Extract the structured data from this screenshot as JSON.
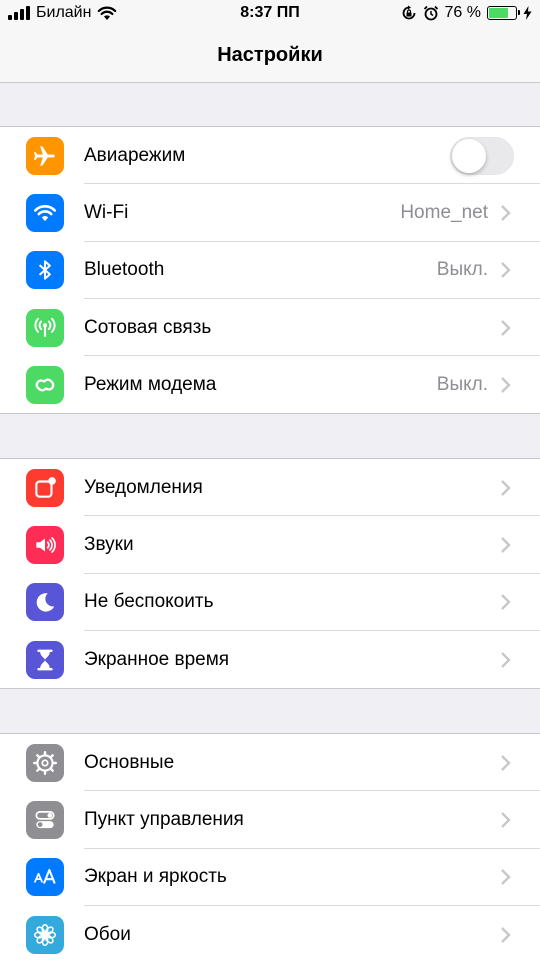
{
  "status": {
    "carrier": "Билайн",
    "time": "8:37 ПП",
    "battery_percent_text": "76 %",
    "battery_level": 0.76,
    "battery_color": "#4cd964"
  },
  "nav": {
    "title": "Настройки"
  },
  "groups": [
    {
      "items": [
        {
          "label": "Авиарежим",
          "icon": "airplane-icon",
          "color": "#ff9500",
          "control": "toggle",
          "toggle_on": false
        },
        {
          "label": "Wi-Fi",
          "icon": "wifi-icon",
          "color": "#007aff",
          "value": "Home_net"
        },
        {
          "label": "Bluetooth",
          "icon": "bluetooth-icon",
          "color": "#007aff",
          "value": "Выкл."
        },
        {
          "label": "Сотовая связь",
          "icon": "cellular-icon",
          "color": "#4cd964",
          "value": ""
        },
        {
          "label": "Режим модема",
          "icon": "hotspot-icon",
          "color": "#4cd964",
          "value": "Выкл."
        }
      ]
    },
    {
      "items": [
        {
          "label": "Уведомления",
          "icon": "notifications-icon",
          "color": "#ff3b30"
        },
        {
          "label": "Звуки",
          "icon": "speaker-icon",
          "color": "#ff2d55"
        },
        {
          "label": "Не беспокоить",
          "icon": "moon-icon",
          "color": "#5856d6"
        },
        {
          "label": "Экранное время",
          "icon": "hourglass-icon",
          "color": "#5856d6"
        }
      ]
    },
    {
      "items": [
        {
          "label": "Основные",
          "icon": "gear-icon",
          "color": "#8e8e93"
        },
        {
          "label": "Пункт управления",
          "icon": "switches-icon",
          "color": "#8e8e93"
        },
        {
          "label": "Экран и яркость",
          "icon": "text-size-icon",
          "color": "#007aff"
        },
        {
          "label": "Обои",
          "icon": "flower-icon",
          "color": "#34aadc"
        }
      ]
    }
  ]
}
